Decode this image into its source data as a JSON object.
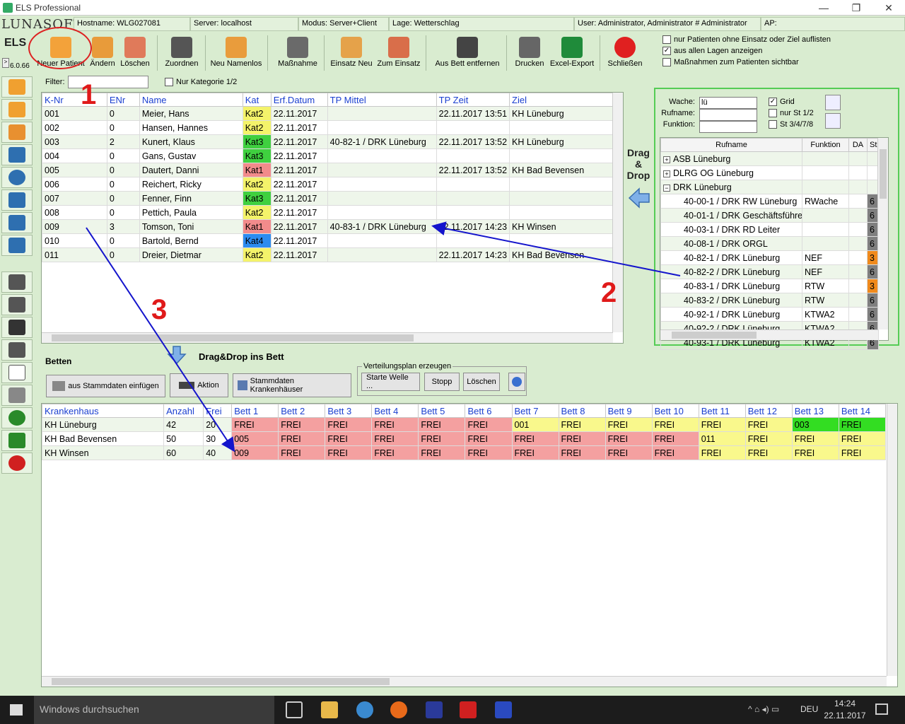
{
  "window": {
    "title": "ELS Professional"
  },
  "info": {
    "hostname": "Hostname: WLG027081",
    "server": "Server: localhost",
    "modus": "Modus: Server+Client",
    "lage": "Lage: Wetterschlag",
    "user": "User: Administrator, Administrator # Administrator",
    "ap": "AP:"
  },
  "brand": {
    "logo": "LUNASOFT",
    "els": "ELS",
    "version": "6.0.66"
  },
  "toolbar": {
    "neuer_patient": "Neuer Patient",
    "aendern": "Ändern",
    "loeschen": "Löschen",
    "zuordnen": "Zuordnen",
    "neu_namenlos": "Neu Namenlos",
    "massnahme": "Maßnahme",
    "einsatz_neu": "Einsatz Neu",
    "zum_einsatz": "Zum Einsatz",
    "aus_bett": "Aus Bett entfernen",
    "drucken": "Drucken",
    "excel": "Excel-Export",
    "schliessen": "Schließen"
  },
  "options": {
    "opt1": "nur Patienten ohne Einsatz oder Ziel auflisten",
    "opt2": "aus allen Lagen anzeigen",
    "opt3": "Maßnahmen zum Patienten sichtbar"
  },
  "filter": {
    "label": "Filter:",
    "kat_label": "Nur Kategorie 1/2"
  },
  "patients": {
    "headers": [
      "K-Nr",
      "ENr",
      "Name",
      "Kat",
      "Erf.Datum",
      "TP Mittel",
      "TP Zeit",
      "Ziel"
    ],
    "rows": [
      {
        "knr": "001",
        "enr": "0",
        "name": "Meier, Hans",
        "kat": "Kat2",
        "datum": "22.11.2017",
        "tp": "",
        "zeit": "22.11.2017 13:51",
        "ziel": "KH Lüneburg"
      },
      {
        "knr": "002",
        "enr": "0",
        "name": "Hansen, Hannes",
        "kat": "Kat2",
        "datum": "22.11.2017",
        "tp": "",
        "zeit": "",
        "ziel": ""
      },
      {
        "knr": "003",
        "enr": "2",
        "name": "Kunert, Klaus",
        "kat": "Kat3",
        "datum": "22.11.2017",
        "tp": "40-82-1 / DRK Lüneburg",
        "zeit": "22.11.2017 13:52",
        "ziel": "KH Lüneburg"
      },
      {
        "knr": "004",
        "enr": "0",
        "name": "Gans, Gustav",
        "kat": "Kat3",
        "datum": "22.11.2017",
        "tp": "",
        "zeit": "",
        "ziel": ""
      },
      {
        "knr": "005",
        "enr": "0",
        "name": "Dautert, Danni",
        "kat": "Kat1",
        "datum": "22.11.2017",
        "tp": "",
        "zeit": "22.11.2017 13:52",
        "ziel": "KH Bad Bevensen"
      },
      {
        "knr": "006",
        "enr": "0",
        "name": "Reichert, Ricky",
        "kat": "Kat2",
        "datum": "22.11.2017",
        "tp": "",
        "zeit": "",
        "ziel": ""
      },
      {
        "knr": "007",
        "enr": "0",
        "name": "Fenner, Finn",
        "kat": "Kat3",
        "datum": "22.11.2017",
        "tp": "",
        "zeit": "",
        "ziel": ""
      },
      {
        "knr": "008",
        "enr": "0",
        "name": "Pettich, Paula",
        "kat": "Kat2",
        "datum": "22.11.2017",
        "tp": "",
        "zeit": "",
        "ziel": ""
      },
      {
        "knr": "009",
        "enr": "3",
        "name": "Tomson, Toni",
        "kat": "Kat1",
        "datum": "22.11.2017",
        "tp": "40-83-1 / DRK Lüneburg",
        "zeit": "22.11.2017 14:23",
        "ziel": "KH Winsen"
      },
      {
        "knr": "010",
        "enr": "0",
        "name": "Bartold, Bernd",
        "kat": "Kat4",
        "datum": "22.11.2017",
        "tp": "",
        "zeit": "",
        "ziel": ""
      },
      {
        "knr": "011",
        "enr": "0",
        "name": "Dreier, Dietmar",
        "kat": "Kat2",
        "datum": "22.11.2017",
        "tp": "",
        "zeit": "22.11.2017 14:23",
        "ziel": "KH Bad Bevensen"
      }
    ]
  },
  "dragdrop": {
    "line1": "Drag",
    "line2": "&",
    "line3": "Drop",
    "bett": "Drag&Drop ins Bett"
  },
  "units": {
    "wache_label": "Wache:",
    "wache_value": "lü",
    "rufname_label": "Rufname:",
    "funktion_label": "Funktion:",
    "grid": "Grid",
    "st12": "nur St 1/2",
    "st3478": "St 3/4/7/8",
    "headers": [
      "Rufname",
      "Funktion",
      "DA",
      "St"
    ],
    "groups": [
      {
        "name": "ASB Lüneburg",
        "toggle": "+"
      },
      {
        "name": "DLRG OG Lüneburg",
        "toggle": "+"
      },
      {
        "name": "DRK Lüneburg",
        "toggle": "−"
      }
    ],
    "rows": [
      {
        "ruf": "40-00-1 / DRK RW Lüneburg",
        "fn": "RWache",
        "st": "6",
        "color": "#7f7f7f"
      },
      {
        "ruf": "40-01-1 / DRK Geschäftsführe",
        "fn": "",
        "st": "6",
        "color": "#7f7f7f"
      },
      {
        "ruf": "40-03-1 / DRK RD Leiter",
        "fn": "",
        "st": "6",
        "color": "#7f7f7f"
      },
      {
        "ruf": "40-08-1 / DRK ORGL",
        "fn": "",
        "st": "6",
        "color": "#7f7f7f"
      },
      {
        "ruf": "40-82-1 / DRK Lüneburg",
        "fn": "NEF",
        "st": "3",
        "color": "#f08a1c"
      },
      {
        "ruf": "40-82-2 / DRK Lüneburg",
        "fn": "NEF",
        "st": "6",
        "color": "#7f7f7f"
      },
      {
        "ruf": "40-83-1 / DRK Lüneburg",
        "fn": "RTW",
        "st": "3",
        "color": "#f08a1c"
      },
      {
        "ruf": "40-83-2 / DRK Lüneburg",
        "fn": "RTW",
        "st": "6",
        "color": "#7f7f7f"
      },
      {
        "ruf": "40-92-1 / DRK Lüneburg",
        "fn": "KTWA2",
        "st": "6",
        "color": "#7f7f7f"
      },
      {
        "ruf": "40-92-2 / DRK Lüneburg",
        "fn": "KTWA2",
        "st": "6",
        "color": "#7f7f7f"
      },
      {
        "ruf": "40-93-1 / DRK Lüneburg",
        "fn": "KTWA2",
        "st": "6",
        "color": "#7f7f7f"
      }
    ]
  },
  "betten": {
    "title": "Betten",
    "btn_stamm": "aus Stammdaten einfügen",
    "btn_aktion": "Aktion",
    "btn_kh": "Stammdaten Krankenhäuser",
    "vplan_label": "Verteilungsplan erzeugen",
    "btn_welle": "Starte Welle ...",
    "btn_stopp": "Stopp",
    "btn_loeschen": "Löschen",
    "headers": [
      "Krankenhaus",
      "Anzahl",
      "Frei",
      "Bett 1",
      "Bett 2",
      "Bett 3",
      "Bett 4",
      "Bett 5",
      "Bett 6",
      "Bett 7",
      "Bett 8",
      "Bett 9",
      "Bett 10",
      "Bett 11",
      "Bett 12",
      "Bett 13",
      "Bett 14"
    ],
    "rows": [
      {
        "kh": "KH Lüneburg",
        "anzahl": "42",
        "frei": "20",
        "beds": [
          [
            "FREI",
            "r"
          ],
          [
            "FREI",
            "r"
          ],
          [
            "FREI",
            "r"
          ],
          [
            "FREI",
            "r"
          ],
          [
            "FREI",
            "r"
          ],
          [
            "FREI",
            "r"
          ],
          [
            "001",
            "y"
          ],
          [
            "FREI",
            "y"
          ],
          [
            "FREI",
            "y"
          ],
          [
            "FREI",
            "y"
          ],
          [
            "FREI",
            "y"
          ],
          [
            "FREI",
            "y"
          ],
          [
            "003",
            "g"
          ],
          [
            "FREI",
            "g"
          ]
        ]
      },
      {
        "kh": "KH Bad Bevensen",
        "anzahl": "50",
        "frei": "30",
        "beds": [
          [
            "005",
            "r"
          ],
          [
            "FREI",
            "r"
          ],
          [
            "FREI",
            "r"
          ],
          [
            "FREI",
            "r"
          ],
          [
            "FREI",
            "r"
          ],
          [
            "FREI",
            "r"
          ],
          [
            "FREI",
            "r"
          ],
          [
            "FREI",
            "r"
          ],
          [
            "FREI",
            "r"
          ],
          [
            "FREI",
            "r"
          ],
          [
            "011",
            "y"
          ],
          [
            "FREI",
            "y"
          ],
          [
            "FREI",
            "y"
          ],
          [
            "FREI",
            "y"
          ]
        ]
      },
      {
        "kh": "KH Winsen",
        "anzahl": "60",
        "frei": "40",
        "beds": [
          [
            "009",
            "r"
          ],
          [
            "FREI",
            "r"
          ],
          [
            "FREI",
            "r"
          ],
          [
            "FREI",
            "r"
          ],
          [
            "FREI",
            "r"
          ],
          [
            "FREI",
            "r"
          ],
          [
            "FREI",
            "r"
          ],
          [
            "FREI",
            "r"
          ],
          [
            "FREI",
            "r"
          ],
          [
            "FREI",
            "r"
          ],
          [
            "FREI",
            "y"
          ],
          [
            "FREI",
            "y"
          ],
          [
            "FREI",
            "y"
          ],
          [
            "FREI",
            "y"
          ]
        ]
      }
    ]
  },
  "annotations": {
    "m1": "1",
    "m2": "2",
    "m3": "3"
  },
  "taskbar": {
    "search": "Windows durchsuchen",
    "lang": "DEU",
    "time": "14:24",
    "date": "22.11.2017"
  }
}
